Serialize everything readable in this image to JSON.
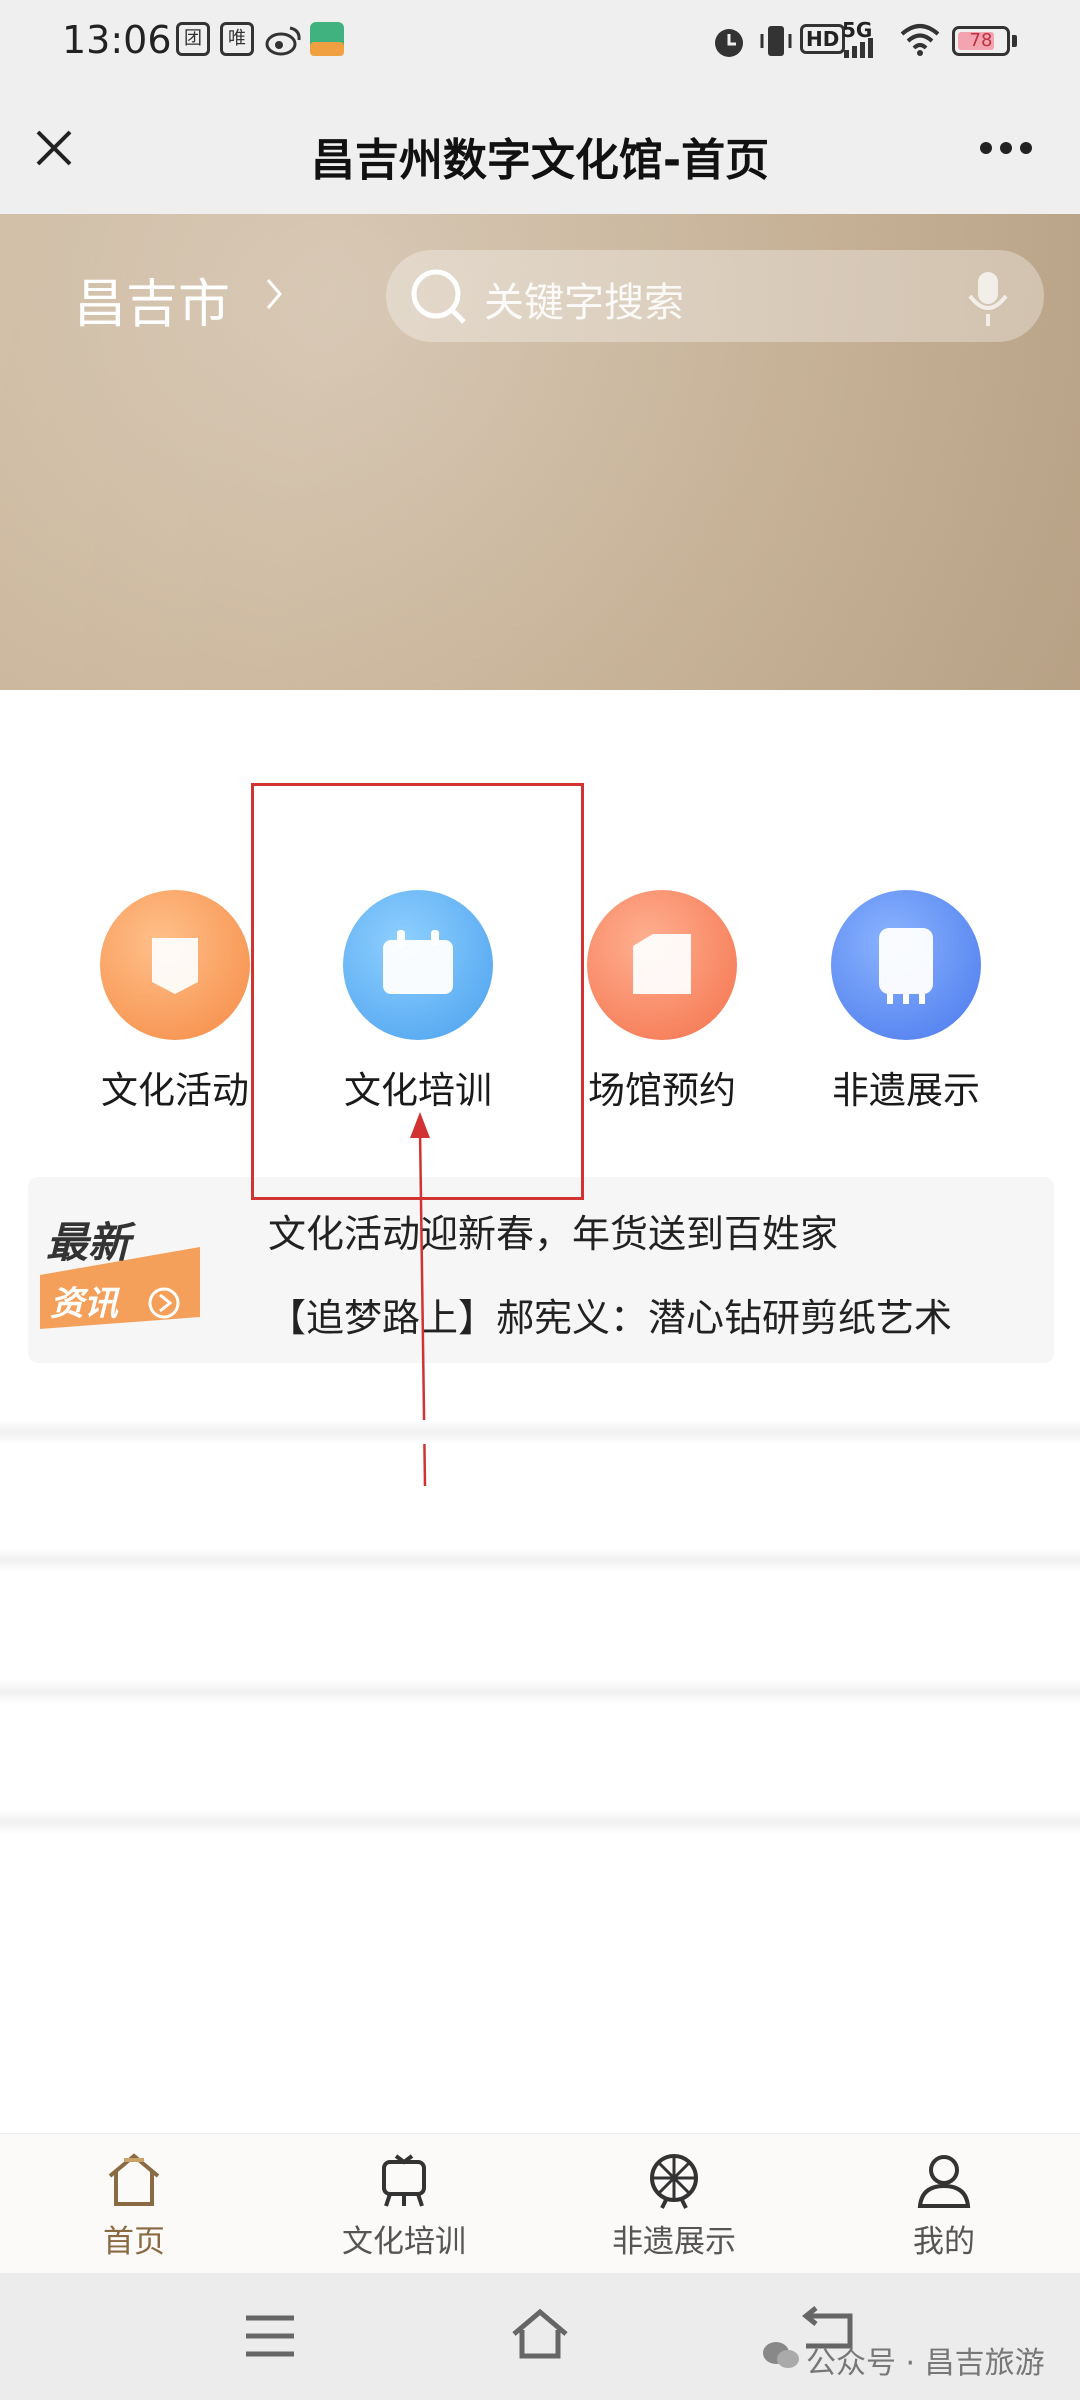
{
  "status_bar": {
    "time": "13:06",
    "app_icons": [
      "团",
      "唯"
    ],
    "network": "5G",
    "hd": "HD",
    "battery_level": "78",
    "battery_fraction": 0.78
  },
  "title_bar": {
    "title": "昌吉州数字文化馆-首页",
    "close_icon": "close-icon",
    "more_icon": "more-dots-icon"
  },
  "banner": {
    "city": "昌吉市",
    "search_placeholder": "关键字搜索"
  },
  "nav": [
    {
      "label": "文化活动",
      "icon": "culture-activity-icon",
      "color": "#f59a5a"
    },
    {
      "label": "文化培训",
      "icon": "culture-training-icon",
      "color": "#5fb0f0"
    },
    {
      "label": "场馆预约",
      "icon": "venue-booking-icon",
      "color": "#f58a6a"
    },
    {
      "label": "非遗展示",
      "icon": "heritage-display-icon",
      "color": "#5b8ef0"
    }
  ],
  "news": {
    "badge_top": "最新",
    "badge_bottom": "资讯",
    "items": [
      "文化活动迎新春，年货送到百姓家",
      "【追梦路上】郝宪义：潜心钻研剪纸艺术"
    ]
  },
  "tab_bar": [
    {
      "label": "首页",
      "icon": "home-icon",
      "active": true
    },
    {
      "label": "文化培训",
      "icon": "training-icon",
      "active": false
    },
    {
      "label": "非遗展示",
      "icon": "heritage-icon",
      "active": false
    },
    {
      "label": "我的",
      "icon": "profile-icon",
      "active": false
    }
  ],
  "watermark": "公众号 · 昌吉旅游",
  "colors": {
    "annotation": "#d23232",
    "tab_active": "#8a6a42"
  }
}
